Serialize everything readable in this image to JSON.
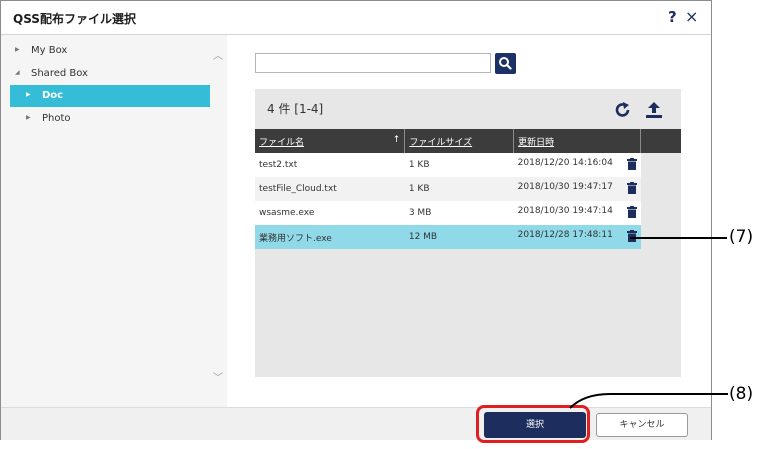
{
  "dialog": {
    "title": "QSS配布ファイル選択",
    "help_label": "?",
    "close_label": "×"
  },
  "sidebar": {
    "items": [
      {
        "label": "My Box"
      },
      {
        "label": "Shared Box"
      },
      {
        "label": "Doc",
        "selected": true
      },
      {
        "label": "Photo"
      }
    ]
  },
  "search": {
    "value": "",
    "placeholder": ""
  },
  "file_panel": {
    "count_label": "4 件  [1-4]",
    "columns": [
      "ファイル名",
      "ファイルサイズ",
      "更新日時"
    ],
    "sort_indicator": "↑",
    "rows": [
      {
        "name": "test2.txt",
        "size": "1 KB",
        "date": "2018/12/20 14:16:04"
      },
      {
        "name": "testFile_Cloud.txt",
        "size": "1 KB",
        "date": "2018/10/30 19:47:17"
      },
      {
        "name": "wsasme.exe",
        "size": "3 MB",
        "date": "2018/10/30 19:47:14"
      },
      {
        "name": "業務用ソフト.exe",
        "size": "12 MB",
        "date": "2018/12/28 17:48:11",
        "selected": true
      }
    ]
  },
  "buttons": {
    "select_label": "選択",
    "cancel_label": "キャンセル"
  },
  "callouts": {
    "c7": "(7)",
    "c8": "(8)"
  },
  "colors": {
    "accent": "#1c2d5e",
    "selected_tree": "#35bcd6",
    "selected_row": "#8fd9e8",
    "callout_ring": "#e02020"
  }
}
